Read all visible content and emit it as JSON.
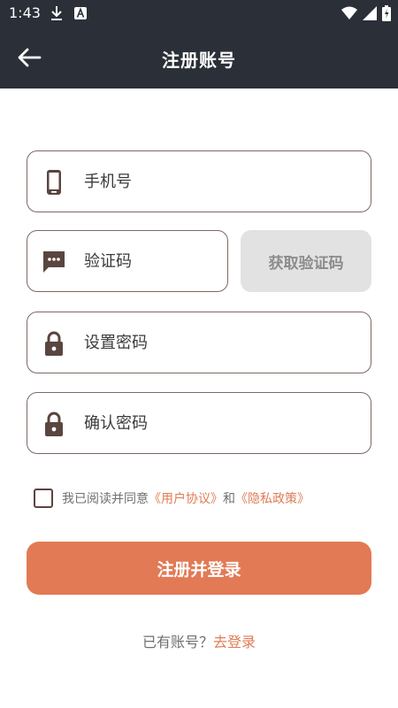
{
  "status_bar": {
    "time": "1:43",
    "icons": [
      "download-icon",
      "a-notification-icon",
      "wifi-icon",
      "signal-icon",
      "battery-icon"
    ]
  },
  "app_bar": {
    "title": "注册账号",
    "back_icon": "arrow-left-icon"
  },
  "form": {
    "phone": {
      "placeholder": "手机号",
      "value": "",
      "icon": "phone-icon"
    },
    "code": {
      "placeholder": "验证码",
      "value": "",
      "icon": "message-icon"
    },
    "get_code_label": "获取验证码",
    "password": {
      "placeholder": "设置密码",
      "value": "",
      "icon": "lock-icon"
    },
    "confirm_password": {
      "placeholder": "确认密码",
      "value": "",
      "icon": "lock-icon"
    }
  },
  "agreement": {
    "prefix": "我已阅读并同意",
    "user_agreement": "《用户协议》",
    "and": "和",
    "privacy_policy": "《隐私政策》",
    "checked": false
  },
  "submit_label": "注册并登录",
  "login_prompt": {
    "text": "已有账号？",
    "link": "去登录"
  },
  "colors": {
    "header_bg": "#2b2f37",
    "accent": "#e27a55",
    "link": "#e07c56",
    "border": "#7a6a62",
    "disabled_bg": "#e2e2e2"
  }
}
